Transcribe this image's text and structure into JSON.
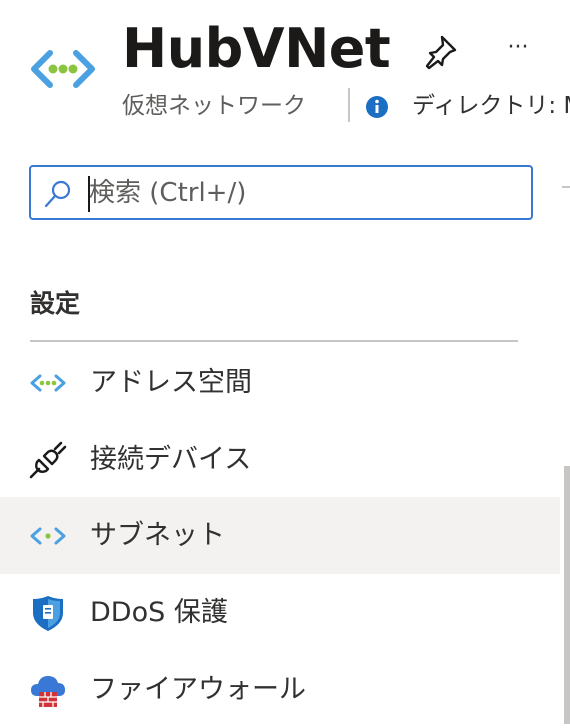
{
  "header": {
    "title": "HubVNet",
    "subtitle": "仮想ネットワーク",
    "directory_text": "ディレクトリ: M",
    "more_label": "···",
    "icon": "virtual-network-icon"
  },
  "search": {
    "placeholder": "検索 (Ctrl+/)",
    "value": ""
  },
  "section": {
    "title": "設定"
  },
  "nav": {
    "items": [
      {
        "label": "アドレス空間",
        "icon": "virtual-network-icon",
        "selected": false
      },
      {
        "label": "接続デバイス",
        "icon": "plug-icon",
        "selected": false
      },
      {
        "label": "サブネット",
        "icon": "virtual-network-icon",
        "selected": true
      },
      {
        "label": "DDoS 保護",
        "icon": "shield-icon",
        "selected": false
      },
      {
        "label": "ファイアウォール",
        "icon": "firewall-icon",
        "selected": false
      }
    ]
  },
  "colors": {
    "accent": "#3a78d6",
    "vnet_blue": "#4aa0e0",
    "vnet_green": "#8bc43f",
    "selected_bg": "#f3f2f1",
    "info_blue": "#1b6ec2"
  }
}
